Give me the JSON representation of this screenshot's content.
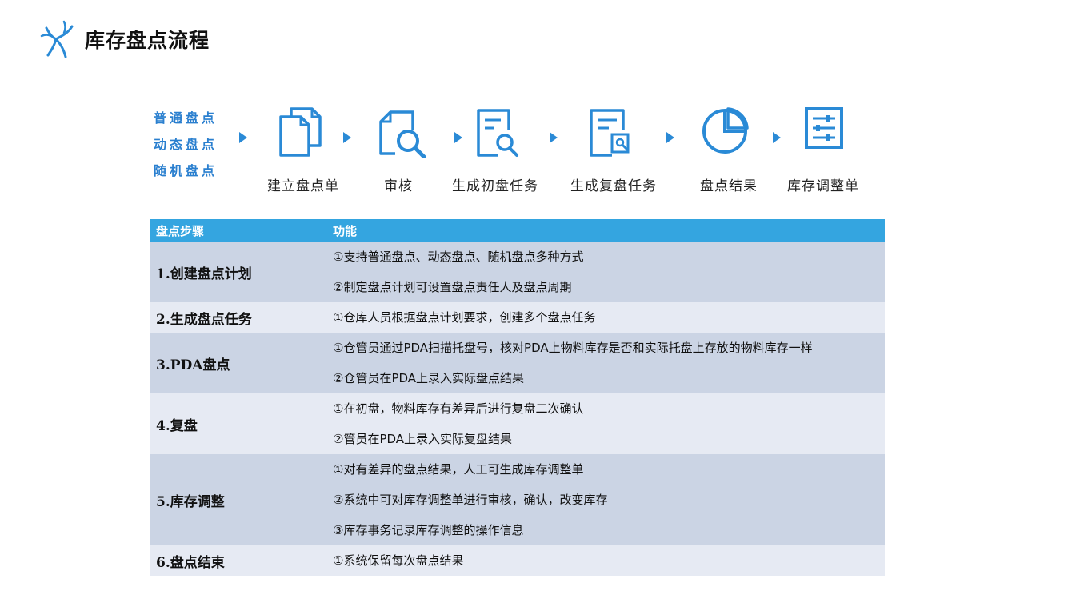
{
  "page": {
    "title": "库存盘点流程"
  },
  "flow": {
    "types": [
      "普通盘点",
      "动态盘点",
      "随机盘点"
    ],
    "steps": [
      {
        "label": "建立盘点单",
        "icon": "documents-icon"
      },
      {
        "label": "审核",
        "icon": "document-search-icon"
      },
      {
        "label": "生成初盘任务",
        "icon": "document-magnify-icon"
      },
      {
        "label": "生成复盘任务",
        "icon": "document-review-icon"
      },
      {
        "label": "盘点结果",
        "icon": "pie-chart-icon"
      },
      {
        "label": "库存调整单",
        "icon": "adjustment-list-icon"
      }
    ]
  },
  "table": {
    "headers": [
      "盘点步骤",
      "功能"
    ],
    "rows": [
      {
        "step": "1.创建盘点计划",
        "functions": [
          "①支持普通盘点、动态盘点、随机盘点多种方式",
          "②制定盘点计划可设置盘点责任人及盘点周期"
        ]
      },
      {
        "step": "2.生成盘点任务",
        "functions": [
          "①仓库人员根据盘点计划要求，创建多个盘点任务"
        ]
      },
      {
        "step": "3.PDA盘点",
        "functions": [
          "①仓管员通过PDA扫描托盘号，核对PDA上物料库存是否和实际托盘上存放的物料库存一样",
          "②仓管员在PDA上录入实际盘点结果"
        ]
      },
      {
        "step": "4.复盘",
        "functions": [
          "①在初盘，物料库存有差异后进行复盘二次确认",
          "②管员在PDA上录入实际复盘结果"
        ]
      },
      {
        "step": "5.库存调整",
        "functions": [
          "①对有差异的盘点结果，人工可生成库存调整单",
          "②系统中可对库存调整单进行审核，确认，改变库存",
          "③库存事务记录库存调整的操作信息"
        ]
      },
      {
        "step": "6.盘点结束",
        "functions": [
          "①系统保留每次盘点结果"
        ]
      }
    ]
  },
  "colors": {
    "accent": "#2a8ad6",
    "header_bg": "#34a5e0",
    "row_dark": "#cbd4e4",
    "row_light": "#e6eaf3"
  }
}
